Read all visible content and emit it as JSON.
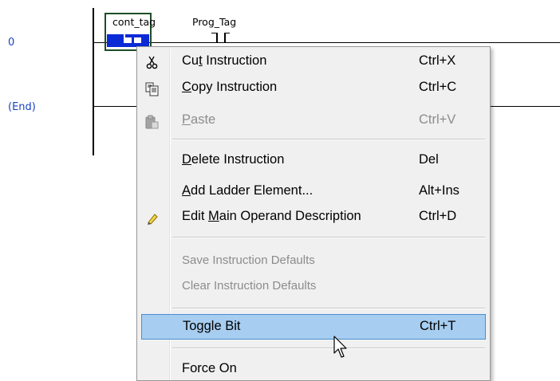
{
  "ladder": {
    "rungs": [
      {
        "number": "0"
      },
      {
        "number": "(End)"
      }
    ],
    "instructions": [
      {
        "tag": "cont_tag"
      },
      {
        "tag": "Prog_Tag"
      }
    ]
  },
  "context_menu": {
    "items": [
      {
        "pre": "Cu",
        "ul": "t",
        "post": " Instruction",
        "shortcut": "Ctrl+X",
        "icon": "scissors-icon",
        "enabled": true
      },
      {
        "pre": "",
        "ul": "C",
        "post": "opy Instruction",
        "shortcut": "Ctrl+C",
        "icon": "copy-icon",
        "enabled": true
      },
      {
        "pre": "",
        "ul": "P",
        "post": "aste",
        "shortcut": "Ctrl+V",
        "icon": "paste-icon",
        "enabled": false
      },
      {
        "pre": "",
        "ul": "D",
        "post": "elete Instruction",
        "shortcut": "Del",
        "enabled": true
      },
      {
        "pre": "",
        "ul": "A",
        "post": "dd Ladder Element...",
        "shortcut": "Alt+Ins",
        "enabled": true
      },
      {
        "pre": "Edit ",
        "ul": "M",
        "post": "ain Operand Description",
        "shortcut": "Ctrl+D",
        "icon": "pencil-icon",
        "enabled": true
      },
      {
        "pre": "Save Instruction Defaults",
        "ul": "",
        "post": "",
        "shortcut": "",
        "enabled": false
      },
      {
        "pre": "Clear Instruction Defaults",
        "ul": "",
        "post": "",
        "shortcut": "",
        "enabled": false
      },
      {
        "pre": "Toggle Bit",
        "ul": "",
        "post": "",
        "shortcut": "Ctrl+T",
        "enabled": true,
        "highlighted": true
      },
      {
        "pre": "Force On",
        "ul": "",
        "post": "",
        "shortcut": "",
        "enabled": true
      }
    ]
  },
  "colors": {
    "rung_number": "#1a44c0",
    "selection": "#0a2ad6",
    "instruction_border": "#1e4d26",
    "menu_highlight": "#a7cdf0"
  }
}
